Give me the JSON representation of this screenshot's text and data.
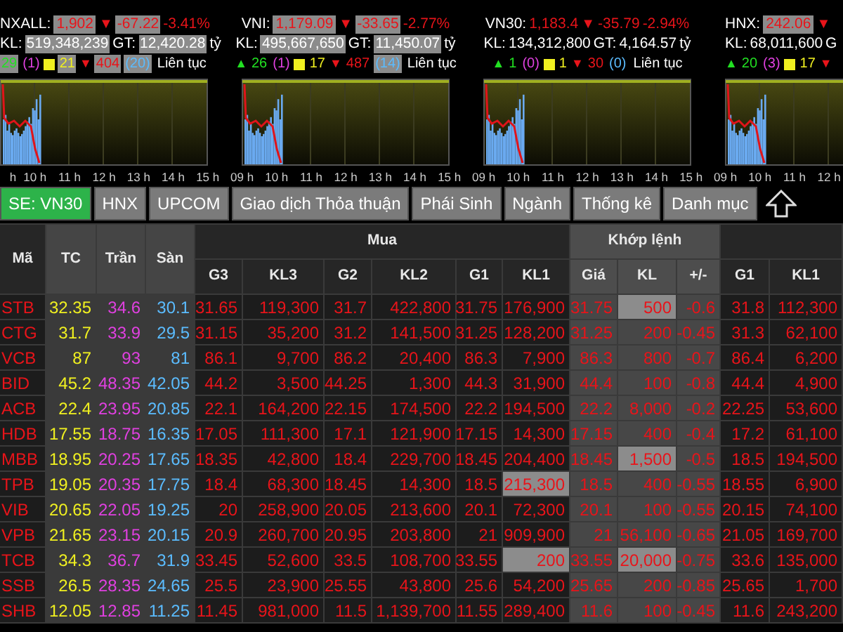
{
  "indices": [
    {
      "name": "NXALL:",
      "value": "1,902",
      "arrow": "▼",
      "change": "-67.22",
      "percent": "-3.41%",
      "boxed": true,
      "kl_label": "KL:",
      "kl": "519,348,239",
      "gt_label": "GT:",
      "gt": "12,420.28",
      "unit": "tỷ",
      "counts": [
        {
          "kind": "up",
          "text": "29",
          "boxed": true
        },
        {
          "kind": "ceiling",
          "text": "(1)",
          "boxed": false
        },
        {
          "kind": "ref",
          "text": "21",
          "boxed": true
        },
        {
          "kind": "down",
          "arrow": "▼",
          "text": "404",
          "boxed": true
        },
        {
          "kind": "floor",
          "text": "(20)",
          "boxed": true
        }
      ],
      "status": "Liên tục",
      "time_labels": [
        "h",
        "10 h",
        "11 h",
        "12 h",
        "13 h",
        "14 h",
        "15 h"
      ]
    },
    {
      "name": "VNI:",
      "value": "1,179.09",
      "arrow": "▼",
      "change": "-33.65",
      "percent": "-2.77%",
      "boxed": true,
      "kl_label": "KL:",
      "kl": "495,667,650",
      "gt_label": "GT:",
      "gt": "11,450.07",
      "unit": "tỷ",
      "counts": [
        {
          "kind": "up",
          "arrow": "▲",
          "text": "26",
          "boxed": false
        },
        {
          "kind": "ceiling",
          "text": "(1)",
          "boxed": false
        },
        {
          "kind": "ref",
          "text": "17",
          "boxed": false
        },
        {
          "kind": "down",
          "arrow": "▼",
          "text": "487",
          "boxed": false
        },
        {
          "kind": "floor",
          "text": "(14)",
          "boxed": true
        }
      ],
      "status": "Liên tục",
      "time_labels": [
        "09 h",
        "10 h",
        "11 h",
        "12 h",
        "13 h",
        "14 h",
        "15 h"
      ]
    },
    {
      "name": "VN30:",
      "value": "1,183.4",
      "arrow": "▼",
      "change": "-35.79",
      "percent": "-2.94%",
      "boxed": false,
      "kl_label": "KL:",
      "kl": "134,312,800",
      "gt_label": "GT:",
      "gt": "4,164.57",
      "unit": "tỷ",
      "counts": [
        {
          "kind": "up",
          "arrow": "▲",
          "text": "1",
          "boxed": false
        },
        {
          "kind": "ceiling",
          "text": "(0)",
          "boxed": false
        },
        {
          "kind": "ref",
          "text": "1",
          "boxed": false
        },
        {
          "kind": "down",
          "arrow": "▼",
          "text": "30",
          "boxed": false
        },
        {
          "kind": "floor",
          "text": "(0)",
          "boxed": false
        }
      ],
      "status": "Liên tục",
      "time_labels": [
        "09 h",
        "10 h",
        "11 h",
        "12 h",
        "13 h",
        "14 h",
        "15 h"
      ]
    },
    {
      "name": "HNX:",
      "value": "242.06",
      "arrow": "▼",
      "boxed": true,
      "kl_label": "KL:",
      "kl": "68,011,600",
      "gt_label": "G",
      "counts": [
        {
          "kind": "up",
          "arrow": "▲",
          "text": "20",
          "boxed": false
        },
        {
          "kind": "ceiling",
          "text": "(3)",
          "boxed": false
        },
        {
          "kind": "ref",
          "text": "17",
          "boxed": false
        },
        {
          "kind": "down",
          "arrow": "▼"
        }
      ],
      "time_labels": [
        "09 h",
        "10 h",
        "11 h",
        "12 h"
      ]
    }
  ],
  "tabs": [
    {
      "label": "SE: VN30",
      "selected": true
    },
    {
      "label": "HNX",
      "selected": false
    },
    {
      "label": "UPCOM",
      "selected": false
    },
    {
      "label": "Giao dịch Thỏa thuận",
      "selected": false
    },
    {
      "label": "Phái Sinh",
      "selected": false
    },
    {
      "label": "Ngành",
      "selected": false
    },
    {
      "label": "Thống kê",
      "selected": false
    },
    {
      "label": "Danh mục",
      "selected": false
    }
  ],
  "columns": {
    "fixed": [
      "Mã",
      "TC",
      "Trần",
      "Sàn"
    ],
    "buy_group": "Mua",
    "buy": [
      "G3",
      "KL3",
      "G2",
      "KL2",
      "G1",
      "KL1"
    ],
    "match_group": "Khớp lệnh",
    "match": [
      "Giá",
      "KL",
      "+/-"
    ],
    "sell": [
      "G1",
      "KL1"
    ]
  },
  "rows": [
    {
      "code": "STB",
      "ref": "32.35",
      "ceiling": "34.6",
      "floor": "30.1",
      "buy": [
        "31.65",
        "119,300",
        "31.7",
        "422,800",
        "31.75",
        "176,900"
      ],
      "price": "31.75",
      "volume": "500",
      "change": "-0.6",
      "sell": [
        "31.8",
        "112,300"
      ],
      "kl1_highlighted": false,
      "volume_highlighted": true
    },
    {
      "code": "CTG",
      "ref": "31.7",
      "ceiling": "33.9",
      "floor": "29.5",
      "buy": [
        "31.15",
        "35,200",
        "31.2",
        "141,500",
        "31.25",
        "128,200"
      ],
      "price": "31.25",
      "volume": "200",
      "change": "-0.45",
      "sell": [
        "31.3",
        "62,100"
      ],
      "kl1_highlighted": false,
      "volume_highlighted": false
    },
    {
      "code": "VCB",
      "ref": "87",
      "ceiling": "93",
      "floor": "81",
      "buy": [
        "86.1",
        "9,700",
        "86.2",
        "20,400",
        "86.3",
        "7,900"
      ],
      "price": "86.3",
      "volume": "800",
      "change": "-0.7",
      "sell": [
        "86.4",
        "6,200"
      ],
      "kl1_highlighted": false,
      "volume_highlighted": false
    },
    {
      "code": "BID",
      "ref": "45.2",
      "ceiling": "48.35",
      "floor": "42.05",
      "buy": [
        "44.2",
        "3,500",
        "44.25",
        "1,300",
        "44.3",
        "31,900"
      ],
      "price": "44.4",
      "volume": "100",
      "change": "-0.8",
      "sell": [
        "44.4",
        "4,900"
      ],
      "kl1_highlighted": false,
      "volume_highlighted": false
    },
    {
      "code": "ACB",
      "ref": "22.4",
      "ceiling": "23.95",
      "floor": "20.85",
      "buy": [
        "22.1",
        "164,200",
        "22.15",
        "174,500",
        "22.2",
        "194,500"
      ],
      "price": "22.2",
      "volume": "8,000",
      "change": "-0.2",
      "sell": [
        "22.25",
        "53,600"
      ],
      "kl1_highlighted": false,
      "volume_highlighted": false
    },
    {
      "code": "HDB",
      "ref": "17.55",
      "ceiling": "18.75",
      "floor": "16.35",
      "buy": [
        "17.05",
        "111,300",
        "17.1",
        "121,900",
        "17.15",
        "14,300"
      ],
      "price": "17.15",
      "volume": "400",
      "change": "-0.4",
      "sell": [
        "17.2",
        "61,100"
      ],
      "kl1_highlighted": false,
      "volume_highlighted": false
    },
    {
      "code": "MBB",
      "ref": "18.95",
      "ceiling": "20.25",
      "floor": "17.65",
      "buy": [
        "18.35",
        "42,800",
        "18.4",
        "229,700",
        "18.45",
        "204,400"
      ],
      "price": "18.45",
      "volume": "1,500",
      "change": "-0.5",
      "sell": [
        "18.5",
        "194,500"
      ],
      "kl1_highlighted": false,
      "volume_highlighted": true
    },
    {
      "code": "TPB",
      "ref": "19.05",
      "ceiling": "20.35",
      "floor": "17.75",
      "buy": [
        "18.4",
        "68,300",
        "18.45",
        "14,300",
        "18.5",
        "215,300"
      ],
      "price": "18.5",
      "volume": "400",
      "change": "-0.55",
      "sell": [
        "18.55",
        "6,900"
      ],
      "kl1_highlighted": true,
      "volume_highlighted": false
    },
    {
      "code": "VIB",
      "ref": "20.65",
      "ceiling": "22.05",
      "floor": "19.25",
      "buy": [
        "20",
        "258,900",
        "20.05",
        "213,600",
        "20.1",
        "72,300"
      ],
      "price": "20.1",
      "volume": "100",
      "change": "-0.55",
      "sell": [
        "20.15",
        "74,100"
      ],
      "kl1_highlighted": false,
      "volume_highlighted": false
    },
    {
      "code": "VPB",
      "ref": "21.65",
      "ceiling": "23.15",
      "floor": "20.15",
      "buy": [
        "20.9",
        "260,700",
        "20.95",
        "203,800",
        "21",
        "909,900"
      ],
      "price": "21",
      "volume": "56,100",
      "change": "-0.65",
      "sell": [
        "21.05",
        "169,700"
      ],
      "kl1_highlighted": false,
      "volume_highlighted": false
    },
    {
      "code": "TCB",
      "ref": "34.3",
      "ceiling": "36.7",
      "floor": "31.9",
      "buy": [
        "33.45",
        "52,600",
        "33.5",
        "108,700",
        "33.55",
        "200"
      ],
      "price": "33.55",
      "volume": "20,000",
      "change": "-0.75",
      "sell": [
        "33.6",
        "135,000"
      ],
      "kl1_highlighted": true,
      "volume_highlighted": true
    },
    {
      "code": "SSB",
      "ref": "26.5",
      "ceiling": "28.35",
      "floor": "24.65",
      "buy": [
        "25.5",
        "23,900",
        "25.55",
        "43,800",
        "25.6",
        "54,200"
      ],
      "price": "25.65",
      "volume": "200",
      "change": "-0.85",
      "sell": [
        "25.65",
        "1,700"
      ],
      "kl1_highlighted": false,
      "volume_highlighted": false
    },
    {
      "code": "SHB",
      "ref": "12.05",
      "ceiling": "12.85",
      "floor": "11.25",
      "buy": [
        "11.45",
        "981,000",
        "11.5",
        "1,139,700",
        "11.55",
        "289,400"
      ],
      "price": "11.6",
      "volume": "100",
      "change": "-0.45",
      "sell": [
        "11.6",
        "243,200"
      ],
      "kl1_highlighted": false,
      "volume_highlighted": false
    }
  ]
}
